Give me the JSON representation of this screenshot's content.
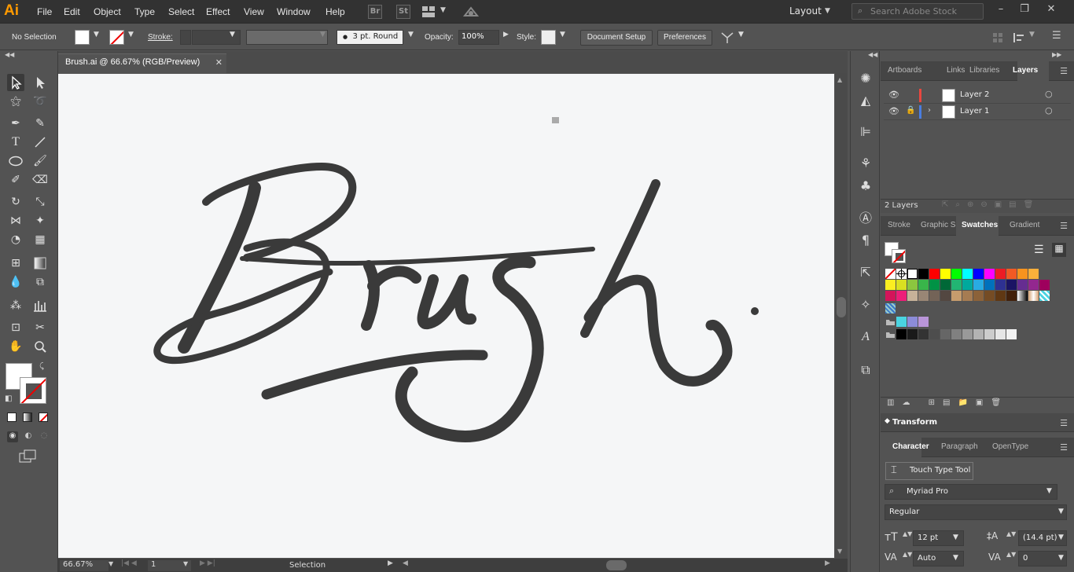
{
  "app": {
    "logo": "Ai"
  },
  "menu": [
    "File",
    "Edit",
    "Object",
    "Type",
    "Select",
    "Effect",
    "View",
    "Window",
    "Help"
  ],
  "menubar": {
    "br": "Br",
    "st": "St",
    "layout": "Layout",
    "search_placeholder": "Search Adobe Stock"
  },
  "control": {
    "selection": "No Selection",
    "stroke_label": "Stroke:",
    "brush": "3 pt. Round",
    "opacity_label": "Opacity:",
    "opacity_value": "100%",
    "style_label": "Style:",
    "doc_setup": "Document Setup",
    "preferences": "Preferences"
  },
  "document": {
    "tab_title": "Brush.ai @ 66.67% (RGB/Preview)",
    "artwork_text": "Brush"
  },
  "status": {
    "zoom": "66.67%",
    "page": "1",
    "tool": "Selection"
  },
  "layers_panel": {
    "tabs": [
      "Artboards",
      "Links",
      "Libraries",
      "Layers"
    ],
    "layers": [
      {
        "name": "Layer 2",
        "color": "#e8473f"
      },
      {
        "name": "Layer 1",
        "color": "#4a7de0"
      }
    ],
    "count": "2 Layers"
  },
  "swatches_panel": {
    "tabs": [
      "Stroke",
      "Graphic S",
      "Swatches",
      "Gradient"
    ]
  },
  "transform": {
    "title": "Transform"
  },
  "character": {
    "tabs": [
      "Character",
      "Paragraph",
      "OpenType"
    ],
    "touch_type": "Touch Type Tool",
    "font": "Myriad Pro",
    "style": "Regular",
    "size": "12 pt",
    "leading": "(14.4 pt)",
    "kerning": "Auto",
    "tracking": "0"
  },
  "swatch_colors": {
    "row1": [
      "#000000",
      "#ff0000",
      "#ffff00",
      "#00ff00",
      "#00ffff",
      "#0000ff",
      "#ff00ff",
      "#ed1c24",
      "#f15a24",
      "#f7931e",
      "#fbb03b"
    ],
    "row2": [
      "#fcee21",
      "#d9e021",
      "#8cc63f",
      "#39b54a",
      "#009245",
      "#006837",
      "#22b573",
      "#00a99d",
      "#29abe2",
      "#0071bc",
      "#2e3192",
      "#1b1464",
      "#662d91",
      "#93278f",
      "#9e005d"
    ],
    "row3": [
      "#d4145a",
      "#ed1e79",
      "#c7b299",
      "#998675",
      "#736357",
      "#534741",
      "#c69c6d",
      "#a67c52",
      "#8c6239",
      "#754c24",
      "#603813",
      "#42210b"
    ],
    "row5": [
      "#4ad4e1",
      "#8c8cd9",
      "#b995d9"
    ],
    "row6": [
      "#000000",
      "#1a1a1a",
      "#333333",
      "#4d4d4d",
      "#666666",
      "#808080",
      "#999999",
      "#b3b3b3",
      "#cccccc",
      "#e6e6e6",
      "#f2f2f2"
    ]
  }
}
